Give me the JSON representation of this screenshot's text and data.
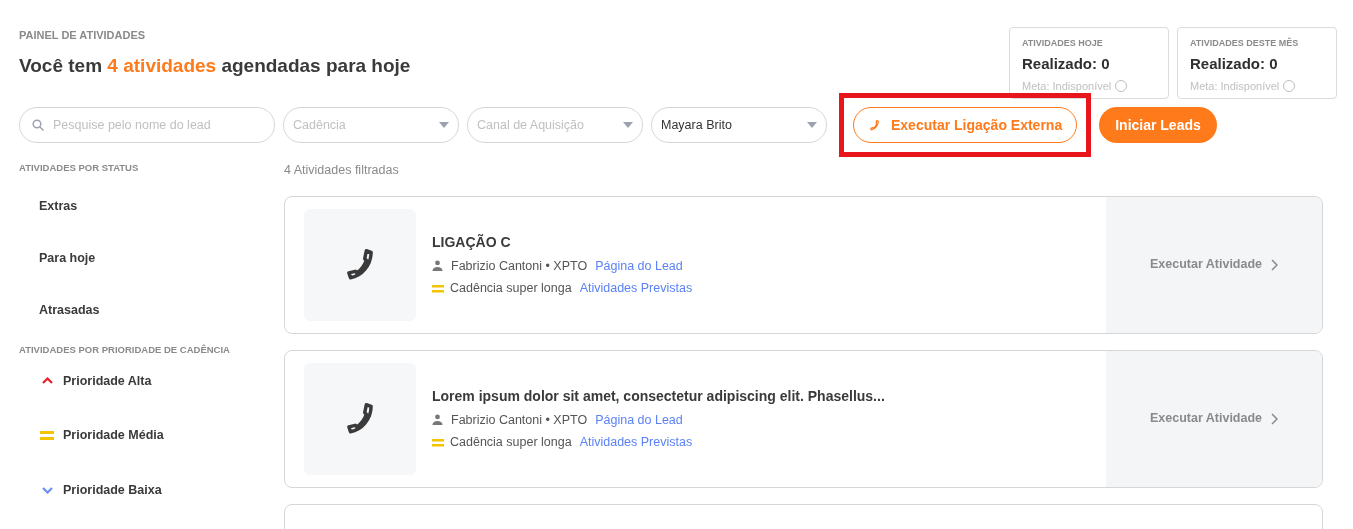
{
  "header": {
    "eyebrow": "PAINEL DE ATIVIDADES",
    "heading": {
      "before": "Você tem",
      "highlight": "4 atividades",
      "after": "agendadas para hoje"
    }
  },
  "stats": [
    {
      "title": "ATIVIDADES HOJE",
      "value": "Realizado: 0",
      "goal": "Meta: Indisponível"
    },
    {
      "title": "ATIVIDADES DESTE MÊS",
      "value": "Realizado: 0",
      "goal": "Meta: Indisponível"
    }
  ],
  "filters": {
    "search": {
      "placeholder": "Pesquise pelo nome do lead"
    },
    "selects": [
      {
        "placeholder": "Cadência"
      },
      {
        "placeholder": "Canal de Aquisição"
      },
      {
        "value": "Mayara Brito"
      }
    ],
    "external_call_button": {
      "label": "Executar Ligação Externa",
      "highlighted": true
    },
    "start_button": "Iniciar Leads"
  },
  "sidebar": {
    "status_title": "ATIVIDADES POR STATUS",
    "status_items": [
      "Extras",
      "Para hoje",
      "Atrasadas"
    ],
    "priority_title": "ATIVIDADES POR PRIORIDADE DE CADÊNCIA",
    "priority_items": [
      {
        "label": "Prioridade Alta",
        "kind": "up",
        "color": "#e8202a"
      },
      {
        "label": "Prioridade Média",
        "kind": "equal",
        "color": "#f5c400"
      },
      {
        "label": "Prioridade Baixa",
        "kind": "down",
        "color": "#6e8df5"
      }
    ]
  },
  "list": {
    "count": "4 Atividades filtradas",
    "activities": [
      {
        "title": "LIGAÇÃO C",
        "lead": "Fabrizio Cantoni • XPTO",
        "lead_link": "Página do Lead",
        "cadence": "Cadência super longa",
        "cadence_link": "Atividades Previstas",
        "action": "Executar Atividade"
      },
      {
        "title": "Lorem ipsum dolor sit amet, consectetur adipiscing elit. Phasellus...",
        "lead": "Fabrizio Cantoni • XPTO",
        "lead_link": "Página do Lead",
        "cadence": "Cadência super longa",
        "cadence_link": "Atividades Previstas",
        "action": "Executar Atividade"
      }
    ]
  }
}
